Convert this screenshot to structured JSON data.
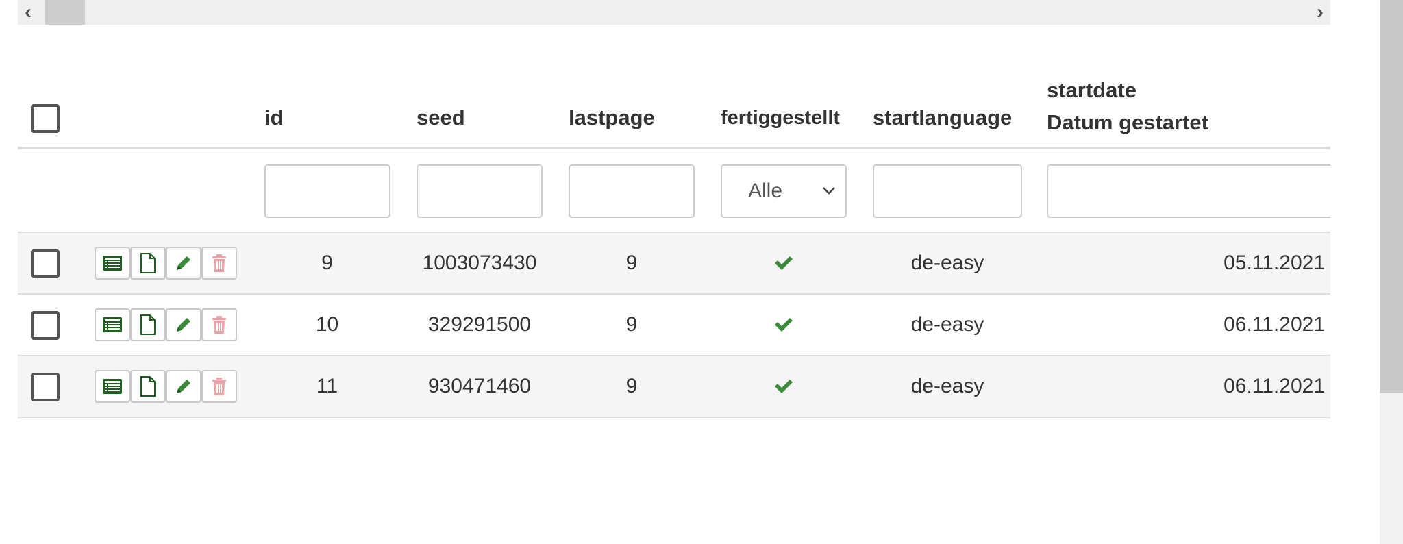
{
  "scroll_h": {
    "left_arrow": "‹",
    "right_arrow": "›"
  },
  "table": {
    "columns": {
      "id": "id",
      "seed": "seed",
      "lastpage": "lastpage",
      "fertiggestellt": "fertiggestellt",
      "startlanguage": "startlanguage",
      "startdate_line1": "startdate",
      "startdate_line2": "Datum gestartet"
    },
    "filters": {
      "id": "",
      "seed": "",
      "lastpage": "",
      "fertiggestellt_selected": "Alle",
      "startlanguage": "",
      "startdate": ""
    },
    "rows": [
      {
        "id": "9",
        "seed": "1003073430",
        "lastpage": "9",
        "fertiggestellt": "check-icon",
        "startlanguage": "de-easy",
        "startdate": "05.11.2021"
      },
      {
        "id": "10",
        "seed": "329291500",
        "lastpage": "9",
        "fertiggestellt": "check-icon",
        "startlanguage": "de-easy",
        "startdate": "06.11.2021"
      },
      {
        "id": "11",
        "seed": "930471460",
        "lastpage": "9",
        "fertiggestellt": "check-icon",
        "startlanguage": "de-easy",
        "startdate": "06.11.2021"
      }
    ],
    "row_actions": [
      "list-view-icon",
      "document-icon",
      "pencil-icon",
      "trash-icon"
    ]
  },
  "colors": {
    "green": "#3a8a3a",
    "dark_green": "#1f5f1f",
    "delete_pink": "#e8a6a6",
    "border": "#dddddd",
    "stripe": "#f5f5f5"
  }
}
